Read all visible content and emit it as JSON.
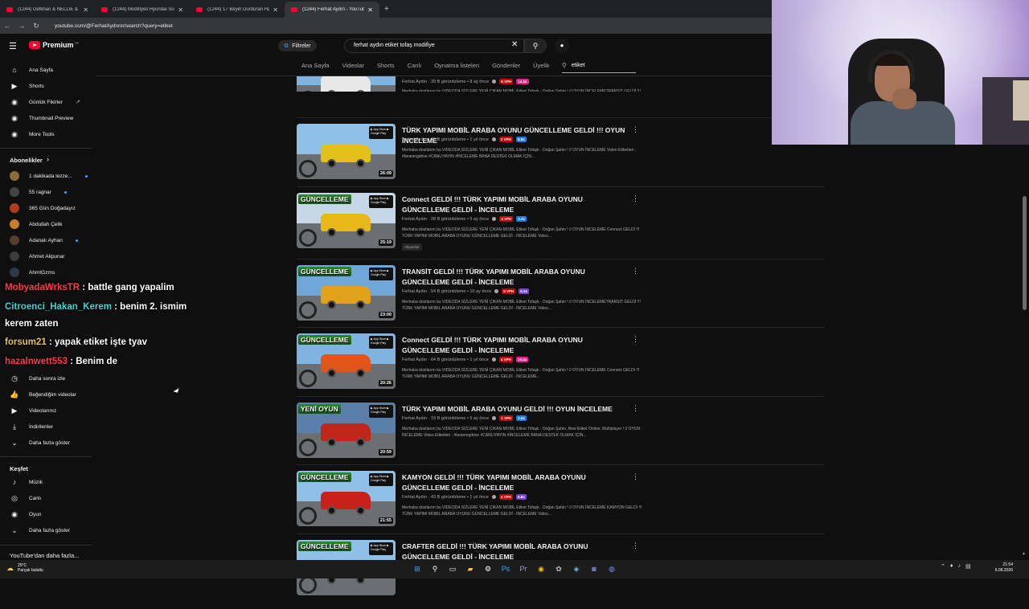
{
  "browser": {
    "tabs": [
      {
        "title": "(1244) Defkhan & NELLIE & Fr...",
        "active": false
      },
      {
        "title": "(1244) Modifiyeli Hyundai Süre...",
        "active": false
      },
      {
        "title": "(1244) 17 Beyin Durduran Hayal...",
        "active": false
      },
      {
        "title": "(1244) Ferhat Aydın - YouTube",
        "active": true
      }
    ],
    "new_tab": "+",
    "url": "youtube.com/@FerhatAydnnn/search?query=etiket"
  },
  "header": {
    "logo_text": "Premium",
    "logo_sup": "TR",
    "filters_label": "Filtreler",
    "search_value": "ferhat aydın etiket tofaş modifiye"
  },
  "channel_tabs": [
    "Ana Sayfa",
    "Videolar",
    "Shorts",
    "Canlı",
    "Oynatma listeleri",
    "Gönderiler",
    "Üyelik"
  ],
  "channel_search_value": "etiket",
  "sidebar": {
    "top": [
      {
        "label": "Ana Sayfa",
        "icon": "home-icon",
        "glyph": "⌂"
      },
      {
        "label": "Shorts",
        "icon": "shorts-icon",
        "glyph": "▶"
      },
      {
        "label": "Günlük Fikirler",
        "icon": "ideas-icon",
        "glyph": "◉"
      },
      {
        "label": "Thumbnail Preview",
        "icon": "thumbnail-icon",
        "glyph": "◉"
      },
      {
        "label": "More Tools",
        "icon": "tools-icon",
        "glyph": "◉"
      }
    ],
    "subscriptions_title": "Abonelikler",
    "subscriptions": [
      {
        "label": "1 dakikada lezze...",
        "color": "#8a6d3b",
        "dot": true
      },
      {
        "label": "55 ragnar",
        "color": "#444444",
        "dot": true
      },
      {
        "label": "365 Gün Doğadayız",
        "color": "#b33a1e",
        "dot": false
      },
      {
        "label": "Abdullah Çelik",
        "color": "#c77d2a",
        "dot": false
      },
      {
        "label": "Adanalı Ayhan",
        "color": "#5a3d2b",
        "dot": true
      },
      {
        "label": "Ahmet Akpunar",
        "color": "#3b3b3b",
        "dot": false
      },
      {
        "label": "AhmtGzms",
        "color": "#2d3a4b",
        "dot": false
      }
    ],
    "you": [
      {
        "label": "Daha sonra izle",
        "icon": "clock-icon",
        "glyph": "◷"
      },
      {
        "label": "Beğendiğim videolar",
        "icon": "like-icon",
        "glyph": "👍"
      },
      {
        "label": "Videolarınız",
        "icon": "video-icon",
        "glyph": "▶"
      },
      {
        "label": "İndirilenler",
        "icon": "download-icon",
        "glyph": "⤓"
      },
      {
        "label": "Daha fazla göster",
        "icon": "chevron-down-icon",
        "glyph": "⌄"
      }
    ],
    "explore_title": "Keşfet",
    "explore": [
      {
        "label": "Müzik",
        "icon": "music-icon",
        "glyph": "♪"
      },
      {
        "label": "Canlı",
        "icon": "live-icon",
        "glyph": "◎"
      },
      {
        "label": "Oyun",
        "icon": "gaming-icon",
        "glyph": "◉"
      },
      {
        "label": "Daha fazla göster",
        "icon": "chevron-down-icon",
        "glyph": "⌄"
      }
    ],
    "more_title": "YouTube'dan daha fazla..."
  },
  "chat": [
    {
      "user": "MobyadaWrksTR",
      "msg": " : battle gang yapalim"
    },
    {
      "user": "Citroenci_Hakan_Kerem",
      "msg": " : benim 2. ismim"
    },
    {
      "user": "",
      "msg": "kerem zaten"
    },
    {
      "user": "forsum21",
      "msg": " : yapak etiket işte tyav"
    },
    {
      "user": "hazalnwett553",
      "msg": " : Benim de"
    }
  ],
  "videos": [
    {
      "title": "",
      "meta": "Ferhat Aydın · 39 B görüntüleme • 8 ay önce",
      "vph": "5 VPH",
      "x": "14.3x",
      "xcolor": "#e0218a",
      "desc": "Merhaba dostlarım bu VIDEODA SİZLERE YENİ ÇIKAN MOBİL Etiket Tofaşk - Doğan Şahin ! // OYUN İNCELEMETRANSİT GELDİ !!! TÜRK YAPIMI MOBİL ARABA OYUNU GÜNCELLEME GELDİ - İNCELEME Video...",
      "dur": "27:19",
      "banner": "",
      "car": "#e8e8e8",
      "sky": "#7fb3e0"
    },
    {
      "title": "TÜRK YAPIMI MOBİL ARABA OYUNU GÜNCELLEME GELDİ !!! OYUN İNCELEME",
      "meta": "Ferhat Aydın · 38 B görüntüleme • 1 yıl önce",
      "vph": "2 VPH",
      "x": "5.5x",
      "xcolor": "#1f7ae0",
      "desc": "Merhaba dostlarım bu VIDEODA SİZLERE YENİ ÇIKAN MOBİL Etiket Tofaşk - Doğan Şahin ! // OYUN İNCELEME Video Etiketleri ; #beamngdrive #CANLIYAYIN #İNCELEME BANA DESTEK OLMAK İÇİN...",
      "dur": "26:09",
      "banner": "",
      "car": "#e3c11a",
      "sky": "#8fc0e8"
    },
    {
      "title": "Connect GELDİ !!! TÜRK YAPIMI MOBİL ARABA OYUNU GÜNCELLEME GELDİ - İNCELEME",
      "meta": "Ferhat Aydın · 28 B görüntüleme • 5 ay önce",
      "vph": "4 VPH",
      "x": "3.3x",
      "xcolor": "#1f7ae0",
      "desc": "Merhaba dostlarım bu VIDEODA SİZLERE YENİ ÇIKAN MOBİL Etiket Tofaşk - Doğan Şahin ! // OYUN İNCELEME Connect GELDİ !!! TÜRK YAPIMI MOBİL ARABA OYUNU GÜNCELLEME GELDİ - İNCELEME Video...",
      "dur": "25:19",
      "banner": "GÜNCELLEME",
      "car": "#e8b81a",
      "sky": "#c6d8e8",
      "tag": "Altyazılar"
    },
    {
      "title": "TRANSİT GELDİ !!! TÜRK YAPIMI MOBİL ARABA OYUNU GÜNCELLEME GELDİ - İNCELEME",
      "meta": "Ferhat Aydın · 54 B görüntüleme • 10 ay önce",
      "vph": "5 VPH",
      "x": "6.3x",
      "xcolor": "#7a3fd6",
      "desc": "Merhaba dostlarım bu VIDEODA SİZLERE YENİ ÇIKAN MOBİL Etiket Tofaşk - Doğan Şahin ! // OYUN İNCELEMETRANSİT GELDİ !!! TÜRK YAPIMI MOBİL ARABA OYUNU GÜNCELLEME GELDİ - İNCELEME Video...",
      "dur": "23:00",
      "banner": "GÜNCELLEME",
      "car": "#e0a21a",
      "sky": "#6fa8d8"
    },
    {
      "title": "Connect GELDİ !!! TÜRK YAPIMI MOBİL ARABA OYUNU GÜNCELLEME GELDİ - İNCELEME",
      "meta": "Ferhat Aydın · 64 B görüntüleme • 1 yıl önce",
      "vph": "4 VPH",
      "x": "10.4x",
      "xcolor": "#e0218a",
      "desc": "Merhaba dostlarım bu VIDEODA SİZLERE YENİ ÇIKAN MOBİL Etiket Tofaşk - Doğan Şahin ! // OYUN İNCELEME Connect GELDİ !!! TÜRK YAPIMI MOBİL ARABA OYUNU GÜNCELLEME GELDİ - İNCELEME...",
      "dur": "20:26",
      "banner": "GÜNCELLEME",
      "car": "#e0561a",
      "sky": "#7fb3e0"
    },
    {
      "title": "TÜRK YAPIMI MOBİL ARABA OYUNU GELDİ !!! OYUN İNCELEME",
      "meta": "Ferhat Aydın · 19 B görüntüleme • 6 ay önce",
      "vph": "1 VPH",
      "x": "2.6x",
      "xcolor": "#1f7ae0",
      "desc": "Merhaba dostlarım bu VIDEODA SİZLERE YENİ ÇIKAN MOBİL Etiket Tofaşk - Doğan Şahin, New Etiket Online: Multiplayer ! // OYUN İNCELEME Video Etiketleri ; #beamngdrive #CANLIYAYIN #İNCELEME BANA DESTEK OLMAK İÇİN...",
      "dur": "20:59",
      "banner": "YENİ OYUN",
      "car": "#c0261a",
      "sky": "#5a7fa8"
    },
    {
      "title": "KAMYON GELDİ !!! TÜRK YAPIMI MOBİL ARABA OYUNU GÜNCELLEME GELDİ - İNCELEME",
      "meta": "Ferhat Aydın · 43 B görüntüleme • 1 yıl önce",
      "vph": "4 VPH",
      "x": "6.8x",
      "xcolor": "#7a3fd6",
      "desc": "Merhaba dostlarım bu VIDEODA SİZLERE YENİ ÇIKAN MOBİL Etiket Tofaşk - Doğan Şahin ! // OYUN İNCELEME KAMYON GELDİ !!! TÜRK YAPIMI MOBİL ARABA OYUNU GÜNCELLEME GELDİ - İNCELEME Video...",
      "dur": "21:55",
      "banner": "GÜNCELLEME",
      "car": "#c8201a",
      "sky": "#8fc0e8"
    },
    {
      "title": "CRAFTER GELDİ !!! TÜRK YAPIMI MOBİL ARABA OYUNU GÜNCELLEME GELDİ - İNCELEME",
      "meta": "",
      "vph": "",
      "x": "",
      "xcolor": "#1f7ae0",
      "desc": "",
      "dur": "",
      "banner": "GÜNCELLEME",
      "car": "#e8e8e8",
      "sky": "#8fc0e8"
    }
  ],
  "taskbar": {
    "weather_temp": "25°C",
    "weather_desc": "Parçalı bulutlu",
    "time": "21:54",
    "date": "6.08.2026"
  }
}
